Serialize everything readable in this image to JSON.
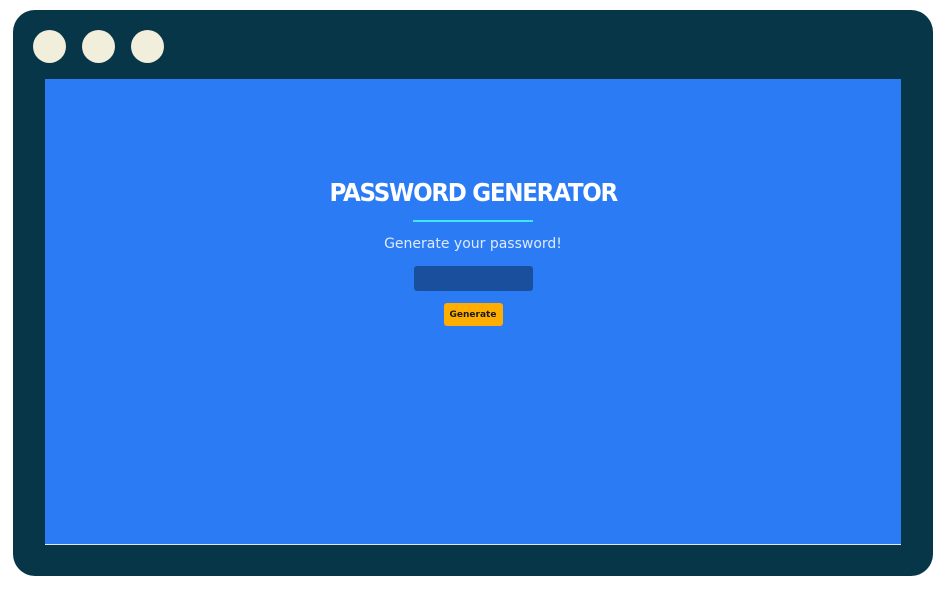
{
  "window": {
    "frame_color": "#073649",
    "controls": [
      "window-dot",
      "window-dot",
      "window-dot"
    ]
  },
  "page": {
    "background": "#2b7bf5",
    "title": "PASSWORD GENERATOR",
    "accent_line_color": "#3ee8ee",
    "subtitle": "Generate your password!",
    "password_field": {
      "value": "",
      "placeholder": ""
    },
    "generate_button": {
      "label": "Generate",
      "color": "#ffae00"
    }
  }
}
